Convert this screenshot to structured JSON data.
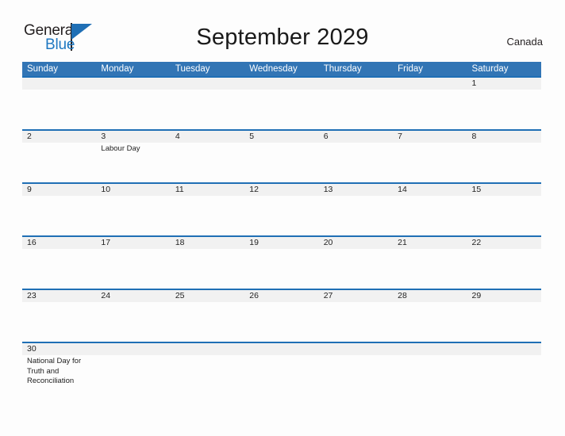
{
  "brand": {
    "name_part1": "General",
    "name_part2": "Blue",
    "flag_icon": "blue-flag-triangle",
    "colors": {
      "dark": "#231f20",
      "blue": "#1f78c1"
    }
  },
  "header": {
    "title": "September 2029",
    "country": "Canada"
  },
  "theme": {
    "header_blue": "#3275b5",
    "divider_blue": "#1f6fb5",
    "date_band_gray": "#f1f1f1",
    "page_background": "#fdfdfd"
  },
  "calendar": {
    "weekdays": [
      "Sunday",
      "Monday",
      "Tuesday",
      "Wednesday",
      "Thursday",
      "Friday",
      "Saturday"
    ],
    "weeks": [
      {
        "days": [
          {
            "date": "",
            "event": ""
          },
          {
            "date": "",
            "event": ""
          },
          {
            "date": "",
            "event": ""
          },
          {
            "date": "",
            "event": ""
          },
          {
            "date": "",
            "event": ""
          },
          {
            "date": "",
            "event": ""
          },
          {
            "date": "1",
            "event": ""
          }
        ]
      },
      {
        "days": [
          {
            "date": "2",
            "event": ""
          },
          {
            "date": "3",
            "event": "Labour Day"
          },
          {
            "date": "4",
            "event": ""
          },
          {
            "date": "5",
            "event": ""
          },
          {
            "date": "6",
            "event": ""
          },
          {
            "date": "7",
            "event": ""
          },
          {
            "date": "8",
            "event": ""
          }
        ]
      },
      {
        "days": [
          {
            "date": "9",
            "event": ""
          },
          {
            "date": "10",
            "event": ""
          },
          {
            "date": "11",
            "event": ""
          },
          {
            "date": "12",
            "event": ""
          },
          {
            "date": "13",
            "event": ""
          },
          {
            "date": "14",
            "event": ""
          },
          {
            "date": "15",
            "event": ""
          }
        ]
      },
      {
        "days": [
          {
            "date": "16",
            "event": ""
          },
          {
            "date": "17",
            "event": ""
          },
          {
            "date": "18",
            "event": ""
          },
          {
            "date": "19",
            "event": ""
          },
          {
            "date": "20",
            "event": ""
          },
          {
            "date": "21",
            "event": ""
          },
          {
            "date": "22",
            "event": ""
          }
        ]
      },
      {
        "days": [
          {
            "date": "23",
            "event": ""
          },
          {
            "date": "24",
            "event": ""
          },
          {
            "date": "25",
            "event": ""
          },
          {
            "date": "26",
            "event": ""
          },
          {
            "date": "27",
            "event": ""
          },
          {
            "date": "28",
            "event": ""
          },
          {
            "date": "29",
            "event": ""
          }
        ]
      },
      {
        "days": [
          {
            "date": "30",
            "event": "National Day for Truth and Reconciliation"
          },
          {
            "date": "",
            "event": ""
          },
          {
            "date": "",
            "event": ""
          },
          {
            "date": "",
            "event": ""
          },
          {
            "date": "",
            "event": ""
          },
          {
            "date": "",
            "event": ""
          },
          {
            "date": "",
            "event": ""
          }
        ]
      }
    ]
  }
}
